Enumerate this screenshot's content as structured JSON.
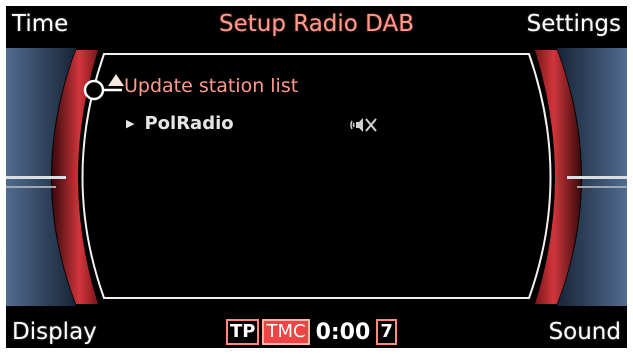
{
  "softkeys": {
    "top_left": "Time",
    "top_right": "Settings",
    "bottom_left": "Display",
    "bottom_right": "Sound"
  },
  "title": "Setup Radio DAB",
  "menu": {
    "items": [
      {
        "label": "Update station list",
        "selected": true
      },
      {
        "label": "PolRadio",
        "selected": false,
        "icon": "audio-mute-icon"
      }
    ]
  },
  "status": {
    "tp": "TP",
    "tmc": "TMC",
    "time": "0:00",
    "channel": "7"
  },
  "colors": {
    "background": "#000000",
    "accent": "#ff9a8c",
    "frame_red": "#c8282e",
    "text": "#ffffff"
  }
}
